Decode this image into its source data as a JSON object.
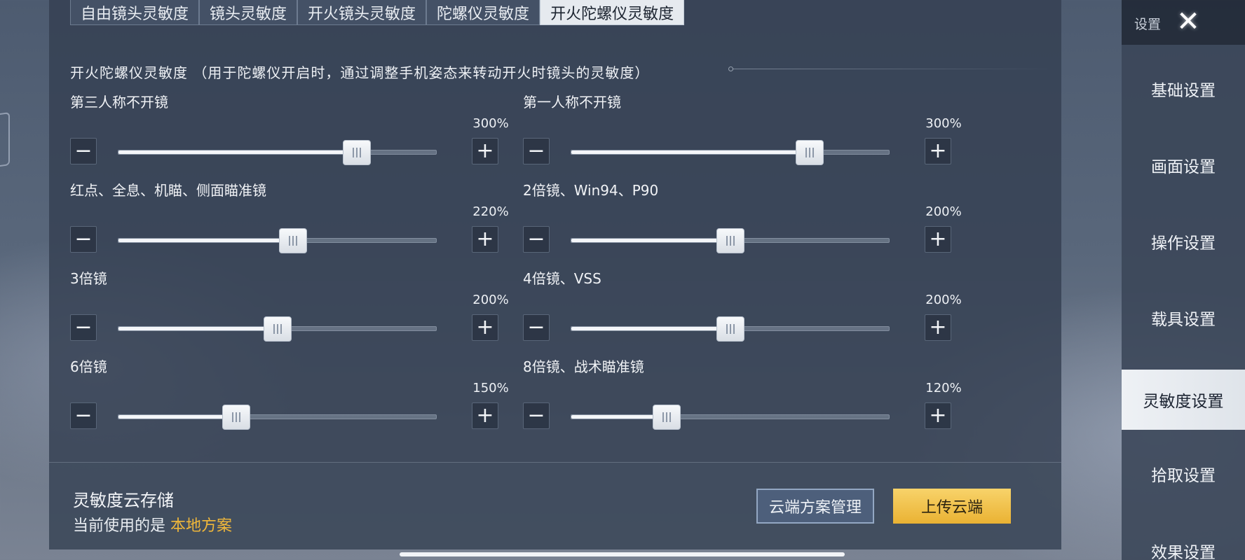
{
  "tabs": [
    {
      "label": "自由镜头灵敏度",
      "active": false
    },
    {
      "label": "镜头灵敏度",
      "active": false
    },
    {
      "label": "开火镜头灵敏度",
      "active": false
    },
    {
      "label": "陀螺仪灵敏度",
      "active": false
    },
    {
      "label": "开火陀螺仪灵敏度",
      "active": true
    }
  ],
  "section_title": "开火陀螺仪灵敏度 （用于陀螺仪开启时，通过调整手机姿态来转动开火时镜头的灵敏度）",
  "settings": [
    {
      "label": "第三人称不开镜",
      "value": "300%",
      "level": 0.75
    },
    {
      "label": "第一人称不开镜",
      "value": "300%",
      "level": 0.75
    },
    {
      "label": "红点、全息、机瞄、侧面瞄准镜",
      "value": "220%",
      "level": 0.55
    },
    {
      "label": "2倍镜、Win94、P90",
      "value": "200%",
      "level": 0.5
    },
    {
      "label": "3倍镜",
      "value": "200%",
      "level": 0.5
    },
    {
      "label": "4倍镜、VSS",
      "value": "200%",
      "level": 0.5
    },
    {
      "label": "6倍镜",
      "value": "150%",
      "level": 0.37
    },
    {
      "label": "8倍镜、战术瞄准镜",
      "value": "120%",
      "level": 0.3
    }
  ],
  "stepper": {
    "minus": "−",
    "plus": "+"
  },
  "cloud": {
    "title": "灵敏度云存储",
    "status_prefix": "当前使用的是 ",
    "plan_name": "本地方案",
    "manage_label": "云端方案管理",
    "upload_label": "上传云端"
  },
  "sidebar": {
    "header_label": "设置",
    "close_glyph": "✕",
    "items": [
      {
        "label": "基础设置",
        "active": false
      },
      {
        "label": "画面设置",
        "active": false
      },
      {
        "label": "操作设置",
        "active": false
      },
      {
        "label": "载具设置",
        "active": false
      },
      {
        "label": "灵敏度设置",
        "active": true
      },
      {
        "label": "拾取设置",
        "active": false
      },
      {
        "label": "效果设置",
        "active": false
      }
    ]
  },
  "colors": {
    "accent_plan": "#f0b73a",
    "upload_button": "#eab233",
    "active_tab_bg": "#e6eaef"
  }
}
